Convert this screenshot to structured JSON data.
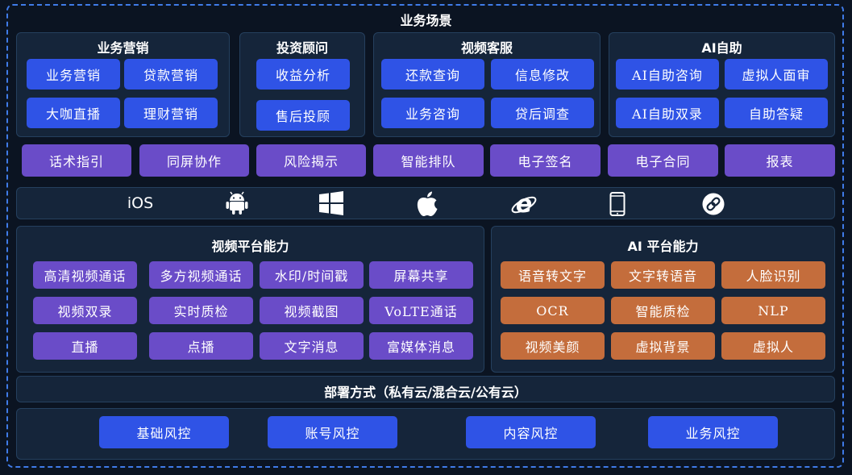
{
  "header": {
    "title": "业务场景"
  },
  "scenarios": [
    {
      "title": "业务营销",
      "items": [
        "业务营销",
        "贷款营销",
        "大咖直播",
        "理财营销"
      ]
    },
    {
      "title": "投资顾问",
      "items": [
        "收益分析",
        "售后投顾"
      ]
    },
    {
      "title": "视频客服",
      "items": [
        "还款查询",
        "信息修改",
        "业务咨询",
        "贷后调查"
      ]
    },
    {
      "title": "AI自助",
      "items": [
        "AI自助咨询",
        "虚拟人面审",
        "AI自助双录",
        "自助答疑"
      ]
    }
  ],
  "features": [
    "话术指引",
    "同屏协作",
    "风险揭示",
    "智能排队",
    "电子签名",
    "电子合同",
    "报表"
  ],
  "platforms": {
    "ios_label": "iOS",
    "icons": [
      "android-icon",
      "windows-icon",
      "apple-icon",
      "ie-icon",
      "mobile-icon",
      "link-icon"
    ]
  },
  "video_platform": {
    "title": "视频平台能力",
    "items": [
      "高清视频通话",
      "多方视频通话",
      "水印/时间戳",
      "屏幕共享",
      "视频双录",
      "实时质检",
      "视频截图",
      "VoLTE通话",
      "直播",
      "点播",
      "文字消息",
      "富媒体消息"
    ]
  },
  "ai_platform": {
    "title": "AI 平台能力",
    "items": [
      "语音转文字",
      "文字转语音",
      "人脸识别",
      "OCR",
      "智能质检",
      "NLP",
      "视频美颜",
      "虚拟背景",
      "虚拟人"
    ]
  },
  "deployment": {
    "title": "部署方式（私有云/混合云/公有云）"
  },
  "risk": {
    "items": [
      "基础风控",
      "账号风控",
      "内容风控",
      "业务风控"
    ]
  },
  "colors": {
    "blue": "#2f53e6",
    "purple": "#6a4cc8",
    "orange": "#c46d3c",
    "panel": "#15253a",
    "border": "#3f7be8"
  }
}
